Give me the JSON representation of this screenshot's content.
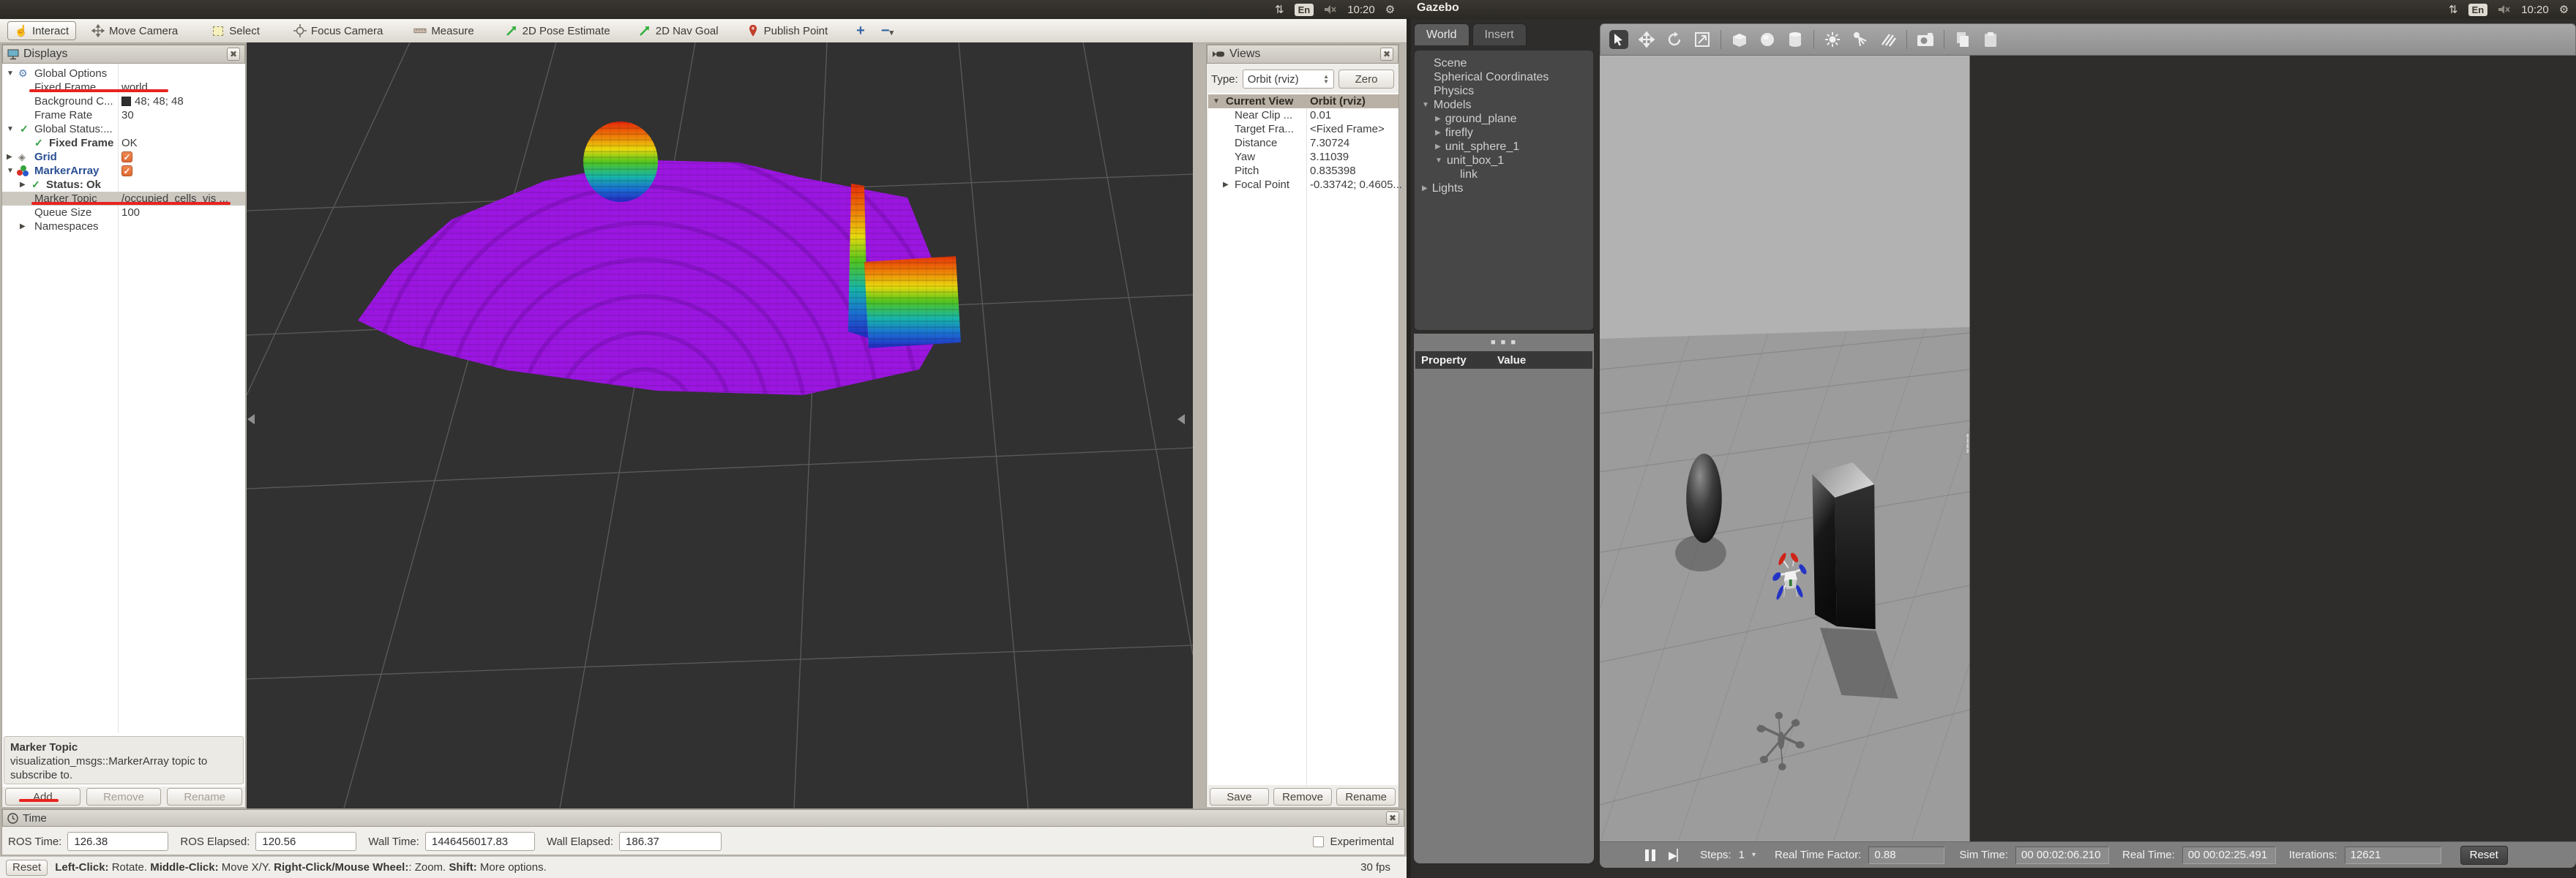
{
  "topbar": {
    "keyboard": "En",
    "time": "10:20",
    "app_title": "Gazebo"
  },
  "rviz": {
    "toolbar": {
      "items": [
        "Interact",
        "Move Camera",
        "Select",
        "Focus Camera",
        "Measure",
        "2D Pose Estimate",
        "2D Nav Goal",
        "Publish Point"
      ]
    },
    "displays": {
      "title": "Displays",
      "rows": [
        {
          "name": "Global Options",
          "value": ""
        },
        {
          "name": "Fixed Frame",
          "value": "world"
        },
        {
          "name": "Background C...",
          "value": "48; 48; 48"
        },
        {
          "name": "Frame Rate",
          "value": "30"
        },
        {
          "name": "Global Status:...",
          "value": ""
        },
        {
          "name": "Fixed Frame",
          "value": "OK"
        },
        {
          "name": "Grid",
          "value": ""
        },
        {
          "name": "MarkerArray",
          "value": ""
        },
        {
          "name": "Status: Ok",
          "value": ""
        },
        {
          "name": "Marker Topic",
          "value": "/occupied_cells_vis ..."
        },
        {
          "name": "Queue Size",
          "value": "100"
        },
        {
          "name": "Namespaces",
          "value": ""
        }
      ],
      "description_title": "Marker Topic",
      "description_body": "visualization_msgs::MarkerArray topic to subscribe to.",
      "add_button": "Add",
      "remove_button": "Remove",
      "rename_button": "Rename"
    },
    "views": {
      "title": "Views",
      "type_label": "Type:",
      "type_value": "Orbit (rviz)",
      "zero_button": "Zero",
      "rows": [
        {
          "name": "Current View",
          "value": "Orbit (rviz)"
        },
        {
          "name": "Near Clip ...",
          "value": "0.01"
        },
        {
          "name": "Target Fra...",
          "value": "<Fixed Frame>"
        },
        {
          "name": "Distance",
          "value": "7.30724"
        },
        {
          "name": "Yaw",
          "value": "3.11039"
        },
        {
          "name": "Pitch",
          "value": "0.835398"
        },
        {
          "name": "Focal Point",
          "value": "-0.33742; 0.4605..."
        }
      ],
      "save_button": "Save",
      "remove_button": "Remove",
      "rename_button": "Rename"
    },
    "time": {
      "title": "Time",
      "fields": [
        {
          "label": "ROS Time:",
          "value": "126.38"
        },
        {
          "label": "ROS Elapsed:",
          "value": "120.56"
        },
        {
          "label": "Wall Time:",
          "value": "1446456017.83"
        },
        {
          "label": "Wall Elapsed:",
          "value": "186.37"
        }
      ],
      "experimental": "Experimental"
    },
    "statusbar": {
      "reset": "Reset",
      "hints": [
        {
          "key": "Left-Click:",
          "text": " Rotate.  "
        },
        {
          "key": "Middle-Click:",
          "text": " Move X/Y.  "
        },
        {
          "key": "Right-Click/Mouse Wheel:",
          "text": ": Zoom.  "
        },
        {
          "key": "Shift:",
          "text": " More options."
        }
      ],
      "fps": "30 fps"
    },
    "scene": {
      "background_color": "#303030",
      "octomap_floor_color": "#9b16e0",
      "colormap": "rainbow (red top, blue bottom)"
    }
  },
  "gazebo": {
    "panel": {
      "tabs": [
        "World",
        "Insert"
      ],
      "tree": [
        {
          "label": "Scene"
        },
        {
          "label": "Spherical Coordinates"
        },
        {
          "label": "Physics"
        },
        {
          "label": "Models"
        },
        {
          "label": "ground_plane"
        },
        {
          "label": "firefly"
        },
        {
          "label": "unit_sphere_1"
        },
        {
          "label": "unit_box_1"
        },
        {
          "label": "link"
        },
        {
          "label": "Lights"
        }
      ],
      "property_col": "Property",
      "value_col": "Value"
    },
    "bottombar": {
      "steps_label": "Steps:",
      "steps_value": "1",
      "rtf_label": "Real Time Factor:",
      "rtf_value": "0.88",
      "sim_label": "Sim Time:",
      "sim_value": "00 00:02:06.210",
      "real_label": "Real Time:",
      "real_value": "00 00:02:25.491",
      "iter_label": "Iterations:",
      "iter_value": "12621",
      "reset": "Reset"
    }
  }
}
